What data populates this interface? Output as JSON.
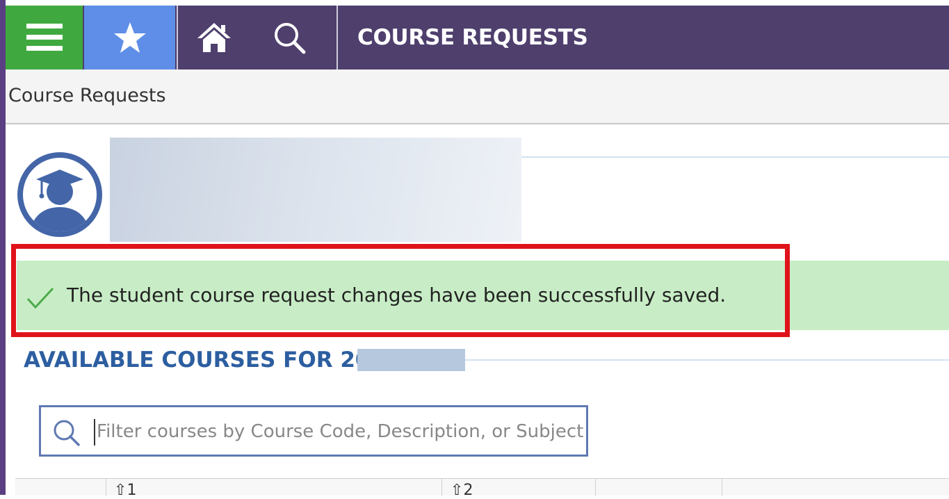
{
  "header": {
    "title": "COURSE REQUESTS",
    "menu_icon": "hamburger-icon",
    "favorite_icon": "star-icon",
    "home_icon": "home-icon",
    "search_icon": "search-icon"
  },
  "breadcrumb": {
    "label": "Course Requests"
  },
  "student": {
    "avatar_icon": "student-graduate-icon"
  },
  "notification": {
    "icon": "checkmark-icon",
    "message": "The student course request changes have been successfully saved."
  },
  "available_courses": {
    "title": "AVAILABLE COURSES FOR 20",
    "filter": {
      "placeholder": "Filter courses by Course Code, Description, or Subject",
      "value": ""
    }
  },
  "grid": {
    "column_labels": [
      "1",
      "2"
    ]
  },
  "colors": {
    "topbar": "#4e3f6d",
    "menu_tile": "#3fa93f",
    "favorite_tile": "#5e8ee7",
    "success_bg": "#c8edc6",
    "highlight_border": "#e0131a",
    "section_title": "#2c5ea0"
  }
}
